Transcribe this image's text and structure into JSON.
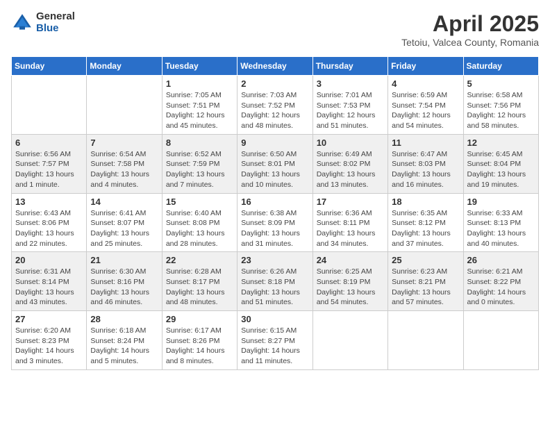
{
  "header": {
    "logo_general": "General",
    "logo_blue": "Blue",
    "month_title": "April 2025",
    "location": "Tetoiu, Valcea County, Romania"
  },
  "days_of_week": [
    "Sunday",
    "Monday",
    "Tuesday",
    "Wednesday",
    "Thursday",
    "Friday",
    "Saturday"
  ],
  "weeks": [
    [
      {
        "day": "",
        "info": ""
      },
      {
        "day": "",
        "info": ""
      },
      {
        "day": "1",
        "info": "Sunrise: 7:05 AM\nSunset: 7:51 PM\nDaylight: 12 hours and 45 minutes."
      },
      {
        "day": "2",
        "info": "Sunrise: 7:03 AM\nSunset: 7:52 PM\nDaylight: 12 hours and 48 minutes."
      },
      {
        "day": "3",
        "info": "Sunrise: 7:01 AM\nSunset: 7:53 PM\nDaylight: 12 hours and 51 minutes."
      },
      {
        "day": "4",
        "info": "Sunrise: 6:59 AM\nSunset: 7:54 PM\nDaylight: 12 hours and 54 minutes."
      },
      {
        "day": "5",
        "info": "Sunrise: 6:58 AM\nSunset: 7:56 PM\nDaylight: 12 hours and 58 minutes."
      }
    ],
    [
      {
        "day": "6",
        "info": "Sunrise: 6:56 AM\nSunset: 7:57 PM\nDaylight: 13 hours and 1 minute."
      },
      {
        "day": "7",
        "info": "Sunrise: 6:54 AM\nSunset: 7:58 PM\nDaylight: 13 hours and 4 minutes."
      },
      {
        "day": "8",
        "info": "Sunrise: 6:52 AM\nSunset: 7:59 PM\nDaylight: 13 hours and 7 minutes."
      },
      {
        "day": "9",
        "info": "Sunrise: 6:50 AM\nSunset: 8:01 PM\nDaylight: 13 hours and 10 minutes."
      },
      {
        "day": "10",
        "info": "Sunrise: 6:49 AM\nSunset: 8:02 PM\nDaylight: 13 hours and 13 minutes."
      },
      {
        "day": "11",
        "info": "Sunrise: 6:47 AM\nSunset: 8:03 PM\nDaylight: 13 hours and 16 minutes."
      },
      {
        "day": "12",
        "info": "Sunrise: 6:45 AM\nSunset: 8:04 PM\nDaylight: 13 hours and 19 minutes."
      }
    ],
    [
      {
        "day": "13",
        "info": "Sunrise: 6:43 AM\nSunset: 8:06 PM\nDaylight: 13 hours and 22 minutes."
      },
      {
        "day": "14",
        "info": "Sunrise: 6:41 AM\nSunset: 8:07 PM\nDaylight: 13 hours and 25 minutes."
      },
      {
        "day": "15",
        "info": "Sunrise: 6:40 AM\nSunset: 8:08 PM\nDaylight: 13 hours and 28 minutes."
      },
      {
        "day": "16",
        "info": "Sunrise: 6:38 AM\nSunset: 8:09 PM\nDaylight: 13 hours and 31 minutes."
      },
      {
        "day": "17",
        "info": "Sunrise: 6:36 AM\nSunset: 8:11 PM\nDaylight: 13 hours and 34 minutes."
      },
      {
        "day": "18",
        "info": "Sunrise: 6:35 AM\nSunset: 8:12 PM\nDaylight: 13 hours and 37 minutes."
      },
      {
        "day": "19",
        "info": "Sunrise: 6:33 AM\nSunset: 8:13 PM\nDaylight: 13 hours and 40 minutes."
      }
    ],
    [
      {
        "day": "20",
        "info": "Sunrise: 6:31 AM\nSunset: 8:14 PM\nDaylight: 13 hours and 43 minutes."
      },
      {
        "day": "21",
        "info": "Sunrise: 6:30 AM\nSunset: 8:16 PM\nDaylight: 13 hours and 46 minutes."
      },
      {
        "day": "22",
        "info": "Sunrise: 6:28 AM\nSunset: 8:17 PM\nDaylight: 13 hours and 48 minutes."
      },
      {
        "day": "23",
        "info": "Sunrise: 6:26 AM\nSunset: 8:18 PM\nDaylight: 13 hours and 51 minutes."
      },
      {
        "day": "24",
        "info": "Sunrise: 6:25 AM\nSunset: 8:19 PM\nDaylight: 13 hours and 54 minutes."
      },
      {
        "day": "25",
        "info": "Sunrise: 6:23 AM\nSunset: 8:21 PM\nDaylight: 13 hours and 57 minutes."
      },
      {
        "day": "26",
        "info": "Sunrise: 6:21 AM\nSunset: 8:22 PM\nDaylight: 14 hours and 0 minutes."
      }
    ],
    [
      {
        "day": "27",
        "info": "Sunrise: 6:20 AM\nSunset: 8:23 PM\nDaylight: 14 hours and 3 minutes."
      },
      {
        "day": "28",
        "info": "Sunrise: 6:18 AM\nSunset: 8:24 PM\nDaylight: 14 hours and 5 minutes."
      },
      {
        "day": "29",
        "info": "Sunrise: 6:17 AM\nSunset: 8:26 PM\nDaylight: 14 hours and 8 minutes."
      },
      {
        "day": "30",
        "info": "Sunrise: 6:15 AM\nSunset: 8:27 PM\nDaylight: 14 hours and 11 minutes."
      },
      {
        "day": "",
        "info": ""
      },
      {
        "day": "",
        "info": ""
      },
      {
        "day": "",
        "info": ""
      }
    ]
  ]
}
